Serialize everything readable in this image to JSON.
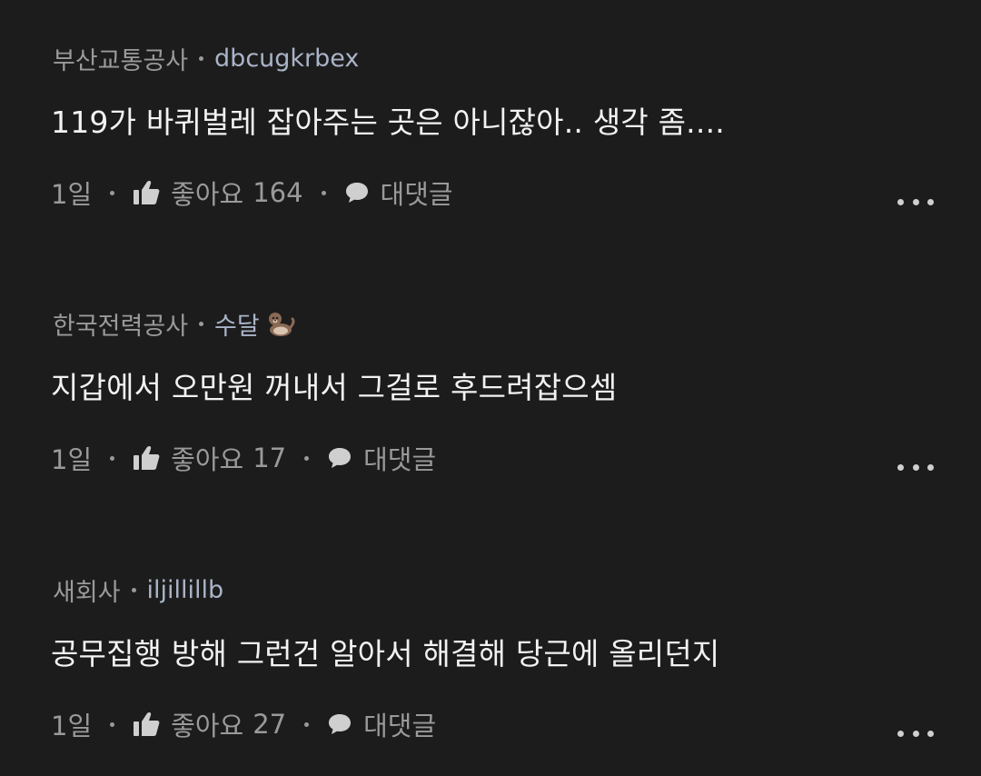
{
  "comments": [
    {
      "company": "부산교통공사",
      "nickname": "dbcugkrbex",
      "text": "119가 바퀴벌레 잡아주는 곳은 아니잖아.. 생각 좀....",
      "time": "1일",
      "like_label": "좋아요",
      "like_count": "164",
      "reply_label": "대댓글"
    },
    {
      "company": "한국전력공사",
      "nickname": "수달",
      "nickname_emoji": "otter-icon",
      "text": "지갑에서 오만원 꺼내서 그걸로 후드려잡으셈",
      "time": "1일",
      "like_label": "좋아요",
      "like_count": "17",
      "reply_label": "대댓글"
    },
    {
      "company": "새회사",
      "nickname": "iljillillb",
      "text": "공무집행 방해 그런건 알아서 해결해 당근에 올리던지",
      "time": "1일",
      "like_label": "좋아요",
      "like_count": "27",
      "reply_label": "대댓글"
    }
  ],
  "colors": {
    "background": "#1c1c1c",
    "text_primary": "#f2f2f2",
    "text_secondary": "#9a9a9a",
    "nickname": "#aab4c8"
  }
}
